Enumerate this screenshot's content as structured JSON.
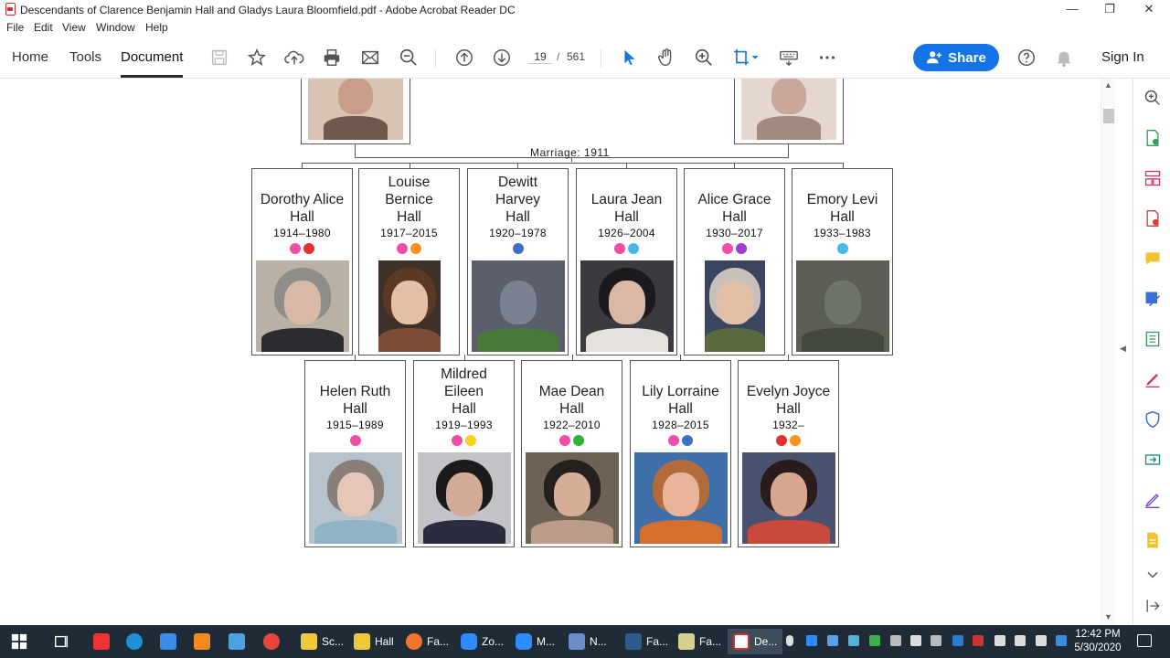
{
  "window": {
    "title": "Descendants of Clarence Benjamin Hall and Gladys Laura Bloomfield.pdf - Adobe Acrobat Reader DC",
    "minimize": "—",
    "restore": "❐",
    "close": "✕"
  },
  "menu": [
    "File",
    "Edit",
    "View",
    "Window",
    "Help"
  ],
  "toolbar": {
    "tabs": [
      "Home",
      "Tools",
      "Document"
    ],
    "active_tab": "Document",
    "page_current": "19",
    "page_separator": "/",
    "page_total": "561",
    "share_label": "Share",
    "sign_in_label": "Sign In",
    "icons": [
      "save-icon",
      "bookmark-star-icon",
      "upload-icon",
      "print-icon",
      "email-icon",
      "zoom-out-icon",
      "page-up-icon",
      "page-down-icon",
      "select-cursor-icon",
      "hand-icon",
      "zoom-in-icon",
      "crop-icon",
      "keyboard-icon",
      "more-icon",
      "help-icon",
      "bell-icon"
    ]
  },
  "chart": {
    "marriage_label": "Marriage: 1911",
    "row1": [
      {
        "name_lines": [
          "Dorothy Alice",
          "Hall"
        ],
        "years": "1914–1980",
        "dots": [
          "#f04ea6",
          "#e53030"
        ]
      },
      {
        "name_lines": [
          "Louise",
          "Bernice",
          "Hall"
        ],
        "years": "1917–2015",
        "dots": [
          "#f04ea6",
          "#f7931e"
        ]
      },
      {
        "name_lines": [
          "Dewitt",
          "Harvey",
          "Hall"
        ],
        "years": "1920–1978",
        "dots": [
          "#3f6fc4"
        ]
      },
      {
        "name_lines": [
          "Laura Jean",
          "Hall"
        ],
        "years": "1926–2004",
        "dots": [
          "#f04ea6",
          "#4bb5e6"
        ]
      },
      {
        "name_lines": [
          "Alice Grace",
          "Hall"
        ],
        "years": "1930–2017",
        "dots": [
          "#f04ea6",
          "#9a3fd0"
        ]
      },
      {
        "name_lines": [
          "Emory Levi",
          "Hall"
        ],
        "years": "1933–1983",
        "dots": [
          "#4bb5e6"
        ]
      }
    ],
    "row2": [
      {
        "name_lines": [
          "Helen Ruth",
          "Hall"
        ],
        "years": "1915–1989",
        "dots": [
          "#f04ea6"
        ]
      },
      {
        "name_lines": [
          "Mildred",
          "Eileen",
          "Hall"
        ],
        "years": "1919–1993",
        "dots": [
          "#f04ea6",
          "#f5d21b"
        ]
      },
      {
        "name_lines": [
          "Mae Dean",
          "Hall"
        ],
        "years": "1922–2010",
        "dots": [
          "#f04ea6",
          "#2fb43a"
        ]
      },
      {
        "name_lines": [
          "Lily Lorraine",
          "Hall"
        ],
        "years": "1928–2015",
        "dots": [
          "#f04ea6",
          "#3f6fc4"
        ]
      },
      {
        "name_lines": [
          "Evelyn Joyce",
          "Hall"
        ],
        "years": "1932–",
        "dots": [
          "#e53030",
          "#f7931e"
        ]
      }
    ]
  },
  "taskbar": {
    "items": [
      "Sc...",
      "Hall",
      "Fa...",
      "Zo...",
      "M...",
      "N...",
      "Fa...",
      "Fa...",
      "De..."
    ],
    "time": "12:42 PM",
    "date": "5/30/2020"
  }
}
